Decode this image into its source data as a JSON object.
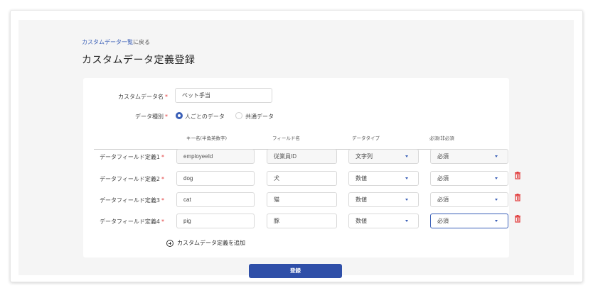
{
  "header": {
    "back_link": "カスタムデータ一覧",
    "back_suffix": "に戻る",
    "title": "カスタムデータ定義登録"
  },
  "form": {
    "name_label": "カスタムデータ名",
    "name_value": "ペット手当",
    "type_label": "データ種別",
    "type_options": [
      "人ごとのデータ",
      "共通データ"
    ],
    "type_selected": "人ごとのデータ",
    "required_mark": "*"
  },
  "columns": [
    "キー名(半角英数字)",
    "フィールド名",
    "データタイプ",
    "必須/非必須"
  ],
  "rows": [
    {
      "label": "データフィールド定義1",
      "key": "employeeId",
      "field": "従業員ID",
      "type": "文字列",
      "required": "必須",
      "deletable": false
    },
    {
      "label": "データフィールド定義2",
      "key": "dog",
      "field": "犬",
      "type": "数値",
      "required": "必須",
      "deletable": true
    },
    {
      "label": "データフィールド定義3",
      "key": "cat",
      "field": "猫",
      "type": "数値",
      "required": "必須",
      "deletable": true
    },
    {
      "label": "データフィールド定義4",
      "key": "pig",
      "field": "豚",
      "type": "数値",
      "required": "必須",
      "deletable": true
    }
  ],
  "add_label": "カスタムデータ定義を追加",
  "submit_label": "登録",
  "colors": {
    "accent": "#3a5fb7",
    "button": "#2f4fa8",
    "delete": "#e23b3b",
    "required": "#e23b3b"
  }
}
